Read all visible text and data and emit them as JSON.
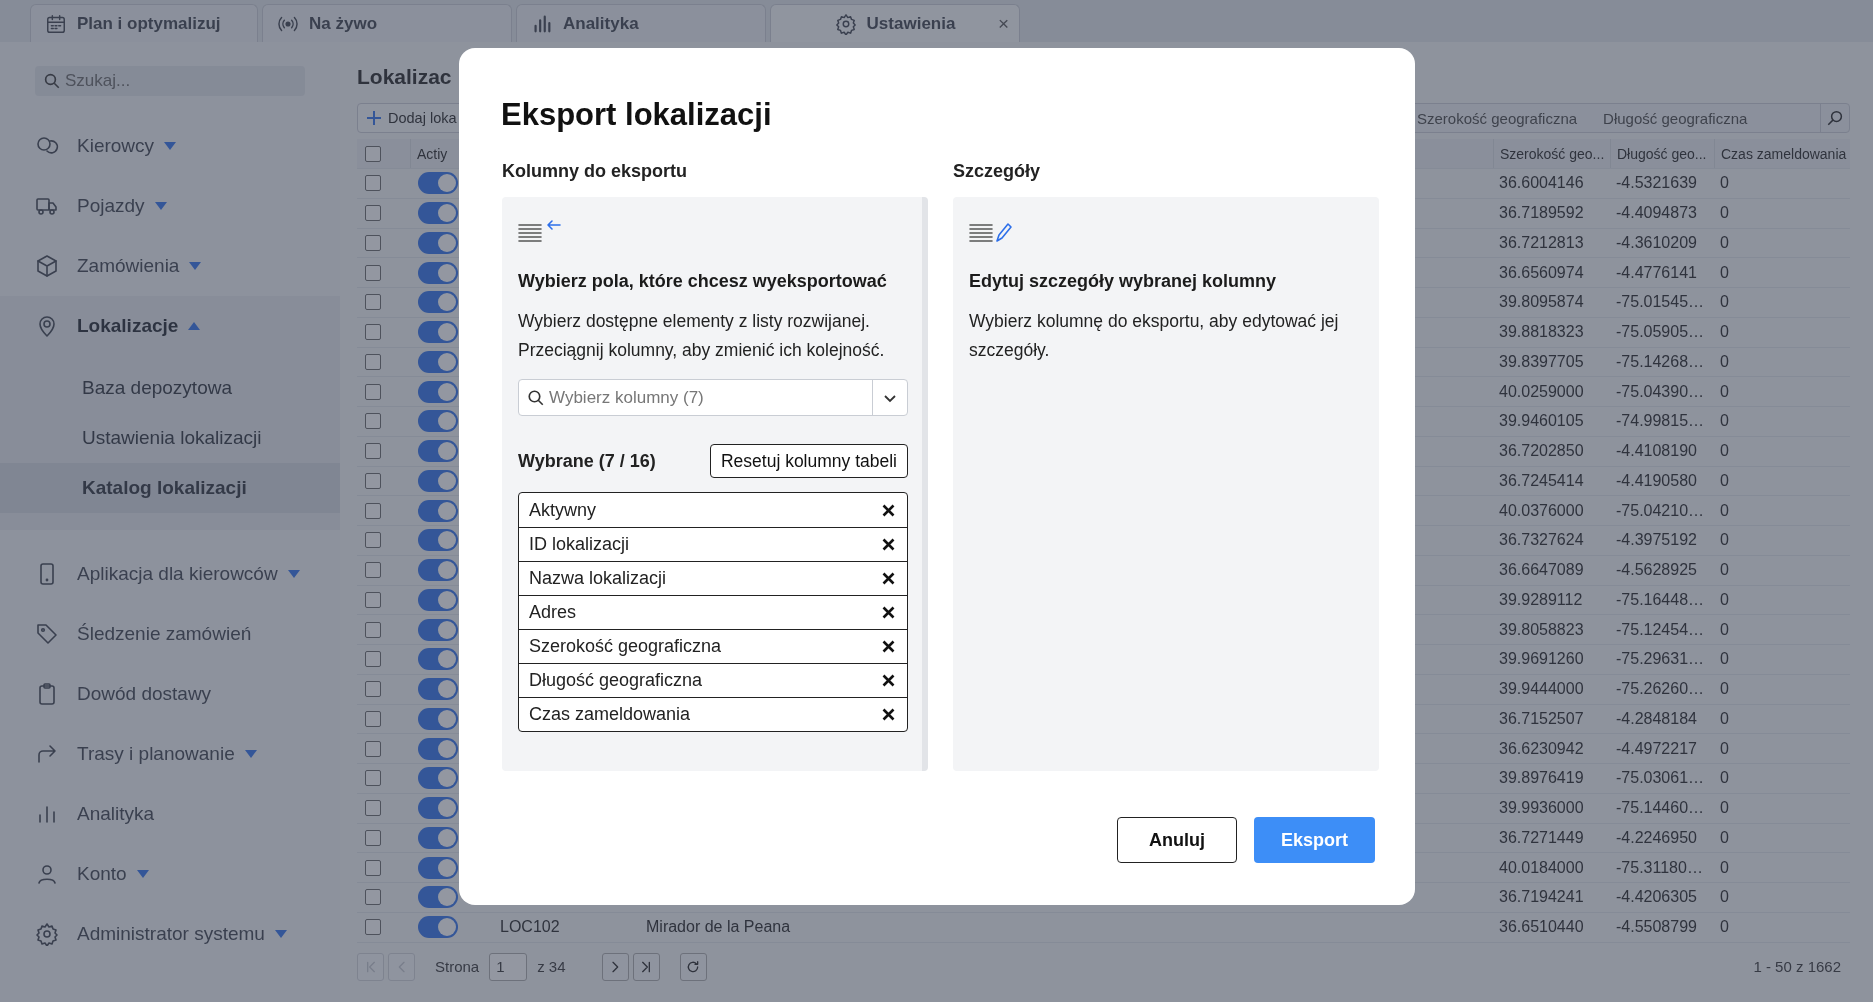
{
  "tabs": [
    {
      "label": "Plan i optymalizuj",
      "selected": false
    },
    {
      "label": "Na żywo",
      "selected": false
    },
    {
      "label": "Analityka",
      "selected": false
    },
    {
      "label": "Ustawienia",
      "selected": true,
      "close": "×"
    }
  ],
  "sidebar": {
    "search": {
      "placeholder": "Szukaj..."
    },
    "items": [
      {
        "label": "Kierowcy",
        "selected": false,
        "expanded": false
      },
      {
        "label": "Pojazdy",
        "selected": false,
        "expanded": false
      },
      {
        "label": "Zamówienia",
        "selected": false,
        "expanded": false
      },
      {
        "label": "Lokalizacje",
        "selected": true,
        "expanded": true,
        "children": [
          {
            "label": "Baza depozytowa",
            "selected": false
          },
          {
            "label": "Ustawienia lokalizacji",
            "selected": false
          },
          {
            "label": "Katalog lokalizacji",
            "selected": true
          }
        ]
      },
      {
        "label": "Aplikacja dla kierowców",
        "selected": false,
        "expanded": false
      },
      {
        "label": "Śledzenie zamówień",
        "selected": false
      },
      {
        "label": "Dowód dostawy",
        "selected": false
      },
      {
        "label": "Trasy i planowanie",
        "selected": false,
        "expanded": false
      },
      {
        "label": "Analityka",
        "selected": false
      },
      {
        "label": "Konto",
        "selected": false,
        "expanded": false
      },
      {
        "label": "Administrator systemu",
        "selected": false,
        "expanded": false
      }
    ]
  },
  "page": {
    "title": "Lokalizac",
    "add_button": "Dodaj loka",
    "column_filter": [
      "Szerokość geograficzna",
      "Długość geograficzna"
    ],
    "table": {
      "header_checked": false,
      "columns": [
        "Actiy",
        "Szerokość geo...",
        "Długość geo...",
        "Czas zameldowania"
      ],
      "rows": [
        {
          "checked": false,
          "active": true,
          "lat": "36.6004146",
          "lon": "-4.5321639",
          "checkin": "0"
        },
        {
          "checked": false,
          "active": true,
          "lat": "36.7189592",
          "lon": "-4.4094873",
          "checkin": "0"
        },
        {
          "checked": false,
          "active": true,
          "lat": "36.7212813",
          "lon": "-4.3610209",
          "checkin": "0"
        },
        {
          "checked": false,
          "active": true,
          "lat": "36.6560974",
          "lon": "-4.4776141",
          "checkin": "0"
        },
        {
          "checked": false,
          "active": true,
          "lat": "39.8095874",
          "lon": "-75.01545…",
          "checkin": "0"
        },
        {
          "checked": false,
          "active": true,
          "lat": "39.8818323",
          "lon": "-75.05905…",
          "checkin": "0"
        },
        {
          "checked": false,
          "active": true,
          "lat": "39.8397705",
          "lon": "-75.14268…",
          "checkin": "0"
        },
        {
          "checked": false,
          "active": true,
          "lat": "40.0259000",
          "lon": "-75.04390…",
          "checkin": "0"
        },
        {
          "checked": false,
          "active": true,
          "lat": "39.9460105",
          "lon": "-74.99815…",
          "checkin": "0"
        },
        {
          "checked": false,
          "active": true,
          "lat": "36.7202850",
          "lon": "-4.4108190",
          "checkin": "0"
        },
        {
          "checked": false,
          "active": true,
          "lat": "36.7245414",
          "lon": "-4.4190580",
          "checkin": "0"
        },
        {
          "checked": false,
          "active": true,
          "lat": "40.0376000",
          "lon": "-75.04210…",
          "checkin": "0"
        },
        {
          "checked": false,
          "active": true,
          "lat": "36.7327624",
          "lon": "-4.3975192",
          "checkin": "0"
        },
        {
          "checked": false,
          "active": true,
          "lat": "36.6647089",
          "lon": "-4.5628925",
          "checkin": "0"
        },
        {
          "checked": false,
          "active": true,
          "lat": "39.9289112",
          "lon": "-75.16448…",
          "checkin": "0"
        },
        {
          "checked": false,
          "active": true,
          "lat": "39.8058823",
          "lon": "-75.12454…",
          "checkin": "0"
        },
        {
          "checked": false,
          "active": true,
          "lat": "39.9691260",
          "lon": "-75.29631…",
          "checkin": "0"
        },
        {
          "checked": false,
          "active": true,
          "lat": "39.9444000",
          "lon": "-75.26260…",
          "checkin": "0"
        },
        {
          "checked": false,
          "active": true,
          "lat": "36.7152507",
          "lon": "-4.2848184",
          "checkin": "0"
        },
        {
          "checked": false,
          "active": true,
          "lat": "36.6230942",
          "lon": "-4.4972217",
          "checkin": "0"
        },
        {
          "checked": false,
          "active": true,
          "lat": "39.8976419",
          "lon": "-75.03061…",
          "checkin": "0"
        },
        {
          "checked": false,
          "active": true,
          "lat": "39.9936000",
          "lon": "-75.14460…",
          "checkin": "0"
        },
        {
          "checked": false,
          "active": true,
          "lat": "36.7271449",
          "lon": "-4.2246950",
          "checkin": "0"
        },
        {
          "checked": false,
          "active": true,
          "lat": "40.0184000",
          "lon": "-75.31180…",
          "checkin": "0"
        },
        {
          "checked": false,
          "active": true,
          "lat": "36.7194241",
          "lon": "-4.4206305",
          "checkin": "0"
        },
        {
          "checked": false,
          "active": true,
          "id": "LOC102",
          "name": "Mirador de la Peana",
          "lat": "36.6510440",
          "lon": "-4.5508799",
          "checkin": "0"
        }
      ]
    },
    "pager": {
      "buttons_before": [
        {
          "kind": "first",
          "disabled": true
        },
        {
          "kind": "prev",
          "disabled": true
        }
      ],
      "page_label": "Strona",
      "page": "1",
      "of": "z 34",
      "buttons_after": [
        {
          "kind": "next",
          "disabled": false
        },
        {
          "kind": "last",
          "disabled": false
        },
        {
          "kind": "refresh",
          "disabled": false
        }
      ],
      "range": "1 - 50 z 1662"
    }
  },
  "dialog": {
    "title": "Eksport lokalizacji",
    "columns_panel": {
      "label": "Kolumny do eksportu",
      "heading": "Wybierz pola, które chcesz  wyeksportować",
      "description": "Wybierz dostępne elementy z listy rozwijanej. Przeciągnij kolumny, aby zmienić ich kolejność.",
      "select": {
        "placeholder": "Wybierz kolumny (7)"
      },
      "selected_label": "Wybrane (7 / 16)",
      "reset_button": "Resetuj kolumny tabeli",
      "selected_columns": [
        "Aktywny",
        "ID lokalizacji",
        "Nazwa lokalizacji",
        "Adres",
        "Szerokość geograficzna",
        "Długość geograficzna",
        "Czas zameldowania"
      ]
    },
    "details_panel": {
      "label": "Szczegóły",
      "heading": "Edytuj szczegóły wybranej kolumny",
      "description": "Wybierz kolumnę do eksportu, aby edytować jej szczegóły."
    },
    "buttons": [
      {
        "label": "Anuluj",
        "kind": "secondary"
      },
      {
        "label": "Eksport",
        "kind": "primary"
      }
    ]
  }
}
